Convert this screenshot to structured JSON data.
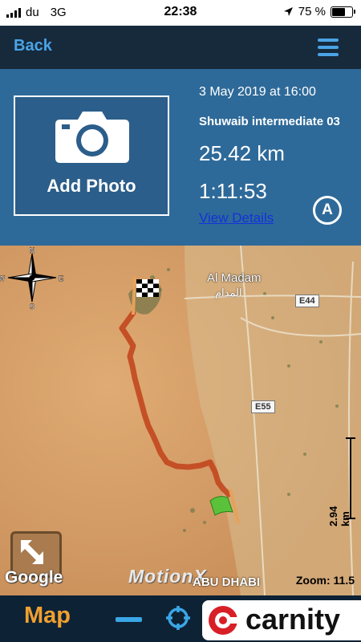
{
  "status": {
    "carrier": "du",
    "network": "3G",
    "time": "22:38",
    "battery": "75 %",
    "battery_level": 0.75
  },
  "nav": {
    "back_label": "Back"
  },
  "track": {
    "add_photo_label": "Add Photo",
    "date": "3 May 2019 at 16:00",
    "route_name": "Shuwaib intermediate 03",
    "distance": "25.42 km",
    "duration": "1:11:53",
    "view_details_label": "View Details",
    "mode_icon_label": "A"
  },
  "map": {
    "town_name": "Al Madam",
    "town_name_ar": "المدام",
    "road_1": "E44",
    "road_2": "E55",
    "city_label": "ABU DHABI",
    "compass": {
      "n": "N",
      "s": "S",
      "e": "E",
      "w": "W"
    },
    "scale_label": "2.94 km",
    "zoom_label": "Zoom: 11.5",
    "google_label": "Google",
    "brand_watermark": "MotionX",
    "colors": {
      "track": "#c1441c",
      "sand": "#d9a46c"
    }
  },
  "bottom": {
    "map_tab_label": "Map",
    "carnity_label": "carnity"
  },
  "icons": [
    "camera-icon",
    "menu-icon",
    "auto-mode-icon",
    "compass-icon",
    "finish-flag-icon",
    "start-flag-icon",
    "expand-icon",
    "zoom-out-icon",
    "locate-icon",
    "carnity-logo-icon"
  ]
}
